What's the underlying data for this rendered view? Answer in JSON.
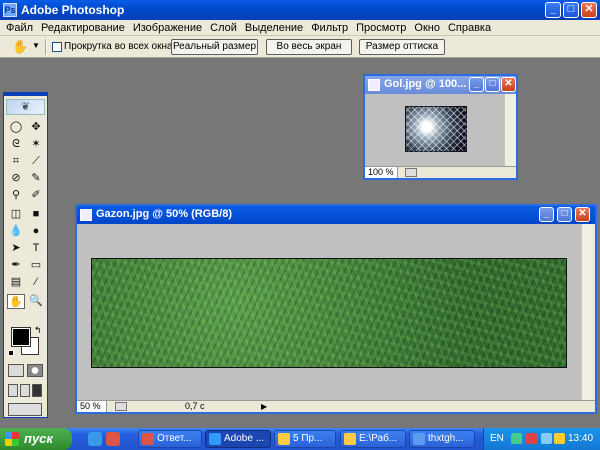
{
  "app": {
    "title": "Adobe Photoshop",
    "icon": "photoshop-app-icon"
  },
  "window_controls": {
    "minimize": "_",
    "maximize": "□",
    "close": "✕"
  },
  "menu": [
    "Файл",
    "Редактирование",
    "Изображение",
    "Слой",
    "Выделение",
    "Фильтр",
    "Просмотр",
    "Окно",
    "Справка"
  ],
  "options": {
    "scroll_all_label": "Прокрутка во всех окнах",
    "actual_pixels": "Реальный размер",
    "fit_screen": "Во весь экран",
    "print_size": "Размер оттиска"
  },
  "tools": {
    "icons": [
      "marquee-icon",
      "move-icon",
      "lasso-icon",
      "magic-wand-icon",
      "crop-icon",
      "slice-icon",
      "healing-brush-icon",
      "brush-icon",
      "clone-stamp-icon",
      "history-brush-icon",
      "eraser-icon",
      "gradient-icon",
      "blur-icon",
      "dodge-icon",
      "path-selection-icon",
      "type-icon",
      "pen-icon",
      "shape-icon",
      "notes-icon",
      "eyedropper-icon",
      "hand-icon",
      "zoom-icon"
    ],
    "glyphs": [
      "◯",
      "✥",
      "ᘓ",
      "✶",
      "⌗",
      "⟋",
      "⊘",
      "✎",
      "⚲",
      "✐",
      "◫",
      "■",
      "💧",
      "●",
      "➤",
      "T",
      "✒",
      "▭",
      "▤",
      "⁄",
      "✋",
      "🔍"
    ]
  },
  "doc_gol": {
    "title": "Gol.jpg @ 100...",
    "zoom": "100 %"
  },
  "doc_gazon": {
    "title": "Gazon.jpg @ 50% (RGB/8)",
    "zoom": "50 %",
    "info": "0,7 с"
  },
  "taskbar": {
    "start": "пуск",
    "tasks": [
      "Ответ...",
      "Adobe ...",
      "5 Пр...",
      "E:\\Раб...",
      "thxtgh..."
    ],
    "lang": "EN",
    "clock": "13:40"
  },
  "colors": {
    "xp_blue": "#0a5ce8",
    "panel": "#ece9d8",
    "workspace": "#777777",
    "start_green": "#3a9a3a"
  }
}
